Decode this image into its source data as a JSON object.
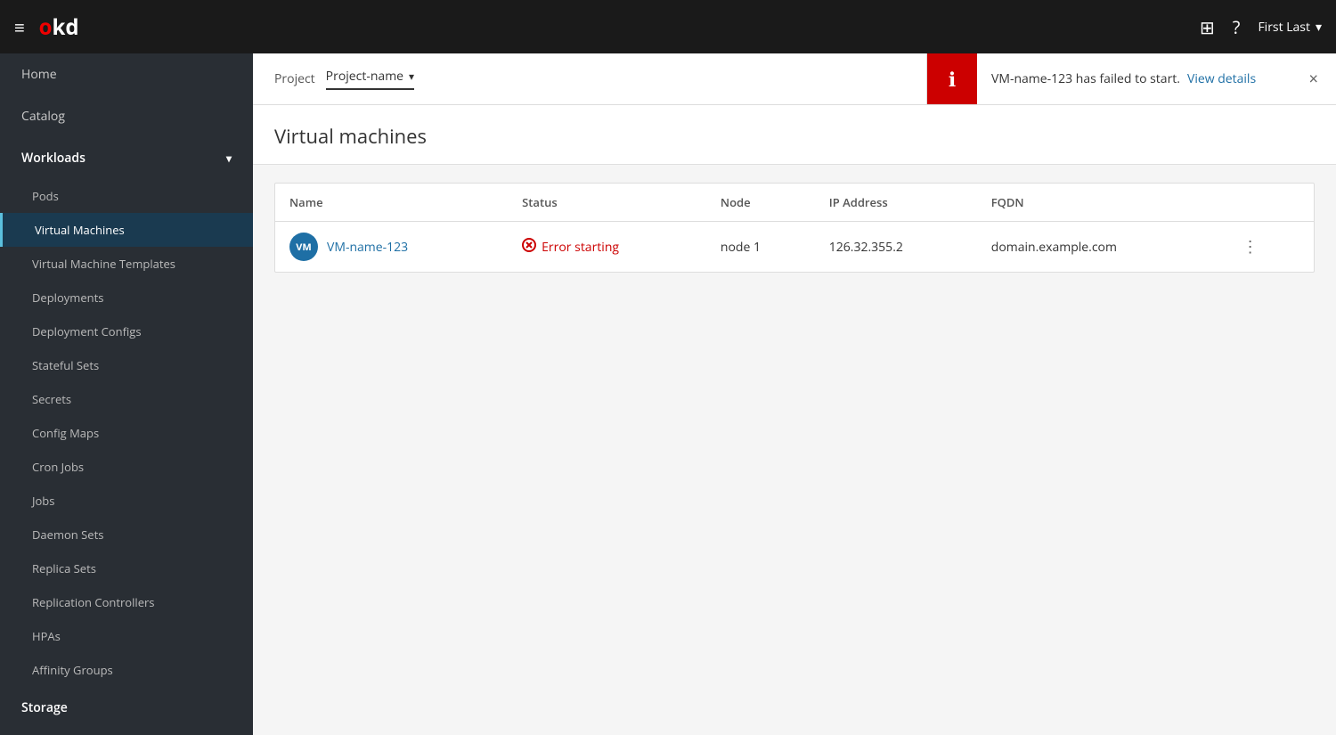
{
  "topnav": {
    "logo": "okd",
    "logo_red": "o",
    "logo_rest": "kd",
    "user_label": "First Last",
    "grid_icon": "⊞",
    "help_icon": "?",
    "hamburger": "≡",
    "chevron_down": "▾"
  },
  "sidebar": {
    "home_label": "Home",
    "catalog_label": "Catalog",
    "workloads_label": "Workloads",
    "storage_label": "Storage",
    "workloads_items": [
      {
        "label": "Pods",
        "id": "pods"
      },
      {
        "label": "Virtual Machines",
        "id": "virtual-machines",
        "active": true
      },
      {
        "label": "Virtual Machine Templates",
        "id": "virtual-machine-templates"
      },
      {
        "label": "Deployments",
        "id": "deployments"
      },
      {
        "label": "Deployment Configs",
        "id": "deployment-configs"
      },
      {
        "label": "Stateful Sets",
        "id": "stateful-sets"
      },
      {
        "label": "Secrets",
        "id": "secrets"
      },
      {
        "label": "Config Maps",
        "id": "config-maps"
      },
      {
        "label": "Cron Jobs",
        "id": "cron-jobs"
      },
      {
        "label": "Jobs",
        "id": "jobs"
      },
      {
        "label": "Daemon Sets",
        "id": "daemon-sets"
      },
      {
        "label": "Replica Sets",
        "id": "replica-sets"
      },
      {
        "label": "Replication Controllers",
        "id": "replication-controllers"
      },
      {
        "label": "HPAs",
        "id": "hpas"
      },
      {
        "label": "Affinity Groups",
        "id": "affinity-groups"
      }
    ]
  },
  "project_bar": {
    "project_label": "Project",
    "project_name": "Project-name"
  },
  "notification": {
    "message": "VM-name-123 has failed to start.",
    "link_text": "View details",
    "close_icon": "×",
    "info_icon": "ℹ"
  },
  "page": {
    "title": "Virtual machines"
  },
  "table": {
    "columns": [
      "Name",
      "Status",
      "Node",
      "IP Address",
      "FQDN"
    ],
    "rows": [
      {
        "name": "VM-name-123",
        "avatar": "VM",
        "status": "Error starting",
        "node": "node 1",
        "ip": "126.32.355.2",
        "fqdn": "domain.example.com"
      }
    ]
  }
}
